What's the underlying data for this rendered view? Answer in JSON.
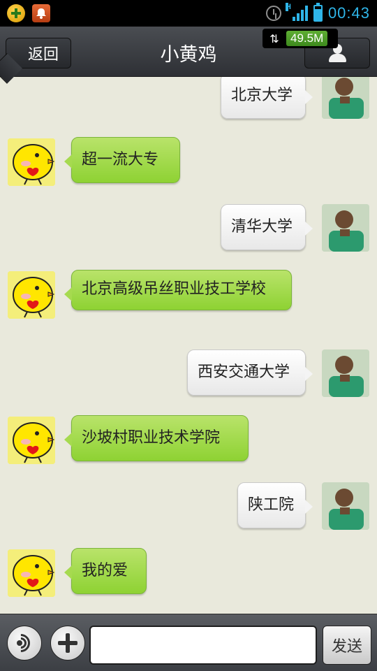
{
  "status_bar": {
    "time": "00:43",
    "signal_type": "H",
    "icons": [
      "app-notification-icon",
      "bell-notification-icon",
      "alarm-icon",
      "signal-icon",
      "battery-icon"
    ]
  },
  "header": {
    "back_label": "返回",
    "title": "小黄鸡",
    "network_speed": "49.5M"
  },
  "messages": [
    {
      "sender": "me",
      "text": "北京大学"
    },
    {
      "sender": "bot",
      "text": "超一流大专"
    },
    {
      "sender": "me",
      "text": "清华大学"
    },
    {
      "sender": "bot",
      "text": "北京高级吊丝职业技工学校"
    },
    {
      "sender": "me",
      "text": "西安交通大学"
    },
    {
      "sender": "bot",
      "text": "沙坡村职业技术学院"
    },
    {
      "sender": "me",
      "text": "陕工院"
    },
    {
      "sender": "bot",
      "text": "我的爱"
    }
  ],
  "input_bar": {
    "message_value": "",
    "send_label": "发送"
  },
  "colors": {
    "incoming_bubble": "#9fd843",
    "outgoing_bubble": "#f2f2f2",
    "chat_background": "#e9e9dc",
    "header_background": "#3a3d42",
    "status_accent": "#2fb5e8"
  }
}
